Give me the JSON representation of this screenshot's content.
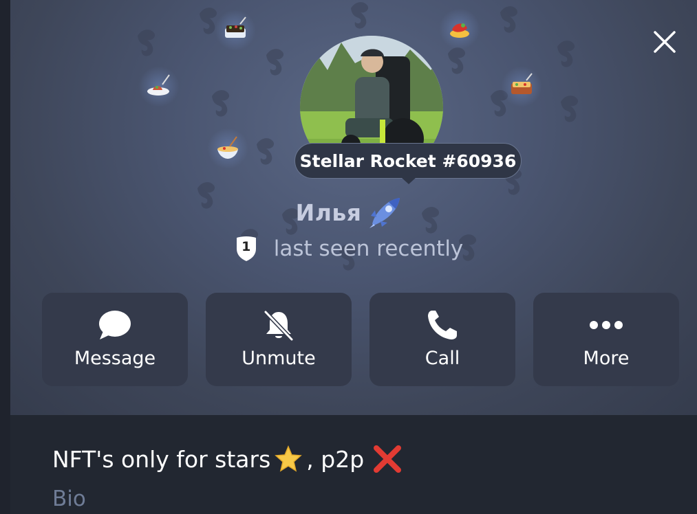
{
  "close": {
    "icon": "close-icon"
  },
  "gift": {
    "tooltip": "Stellar Rocket #60936"
  },
  "profile": {
    "name": "Илья",
    "status": "last seen recently",
    "badge_number": "1"
  },
  "actions": [
    {
      "label": "Message",
      "icon": "message-bubble-icon"
    },
    {
      "label": "Unmute",
      "icon": "bell-off-icon"
    },
    {
      "label": "Call",
      "icon": "phone-icon"
    },
    {
      "label": "More",
      "icon": "more-dots-icon"
    }
  ],
  "bio": {
    "text_before": "NFT's only for stars",
    "text_middle": ", p2p",
    "label": "Bio"
  },
  "colors": {
    "header_bg": "#4a5570",
    "button_bg": "#343a4b",
    "bio_bg": "#222731",
    "bio_label": "#6f7c96"
  }
}
